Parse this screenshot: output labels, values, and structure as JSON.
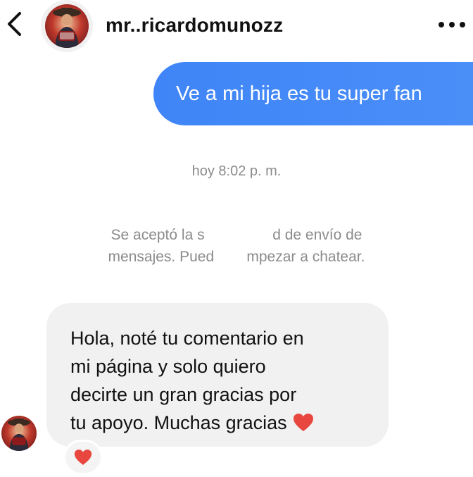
{
  "header": {
    "username": "mr..ricardomunozz",
    "back_icon": "chevron-left-icon",
    "more_icon": "more-horizontal-icon"
  },
  "messages": {
    "sent_text": "Ve a mi hija es tu super fan",
    "timestamp": "hoy 8:02 p. m.",
    "notice_line1": "Se aceptó la s       d de envío de",
    "notice_line2": "mensajes. Pued   mpezar a chatear.",
    "received_lines": [
      "Hola, noté tu comentario en",
      "mi página y solo quiero",
      "decirte un gran gracias por",
      "tu apoyo. Muchas gracias"
    ],
    "reaction_icon": "heart-icon"
  },
  "colors": {
    "sent_bubble": "#4189f7",
    "received_bubble": "#f1f1f1",
    "muted_text": "#8b8b8b",
    "heart": "#e8473f"
  }
}
